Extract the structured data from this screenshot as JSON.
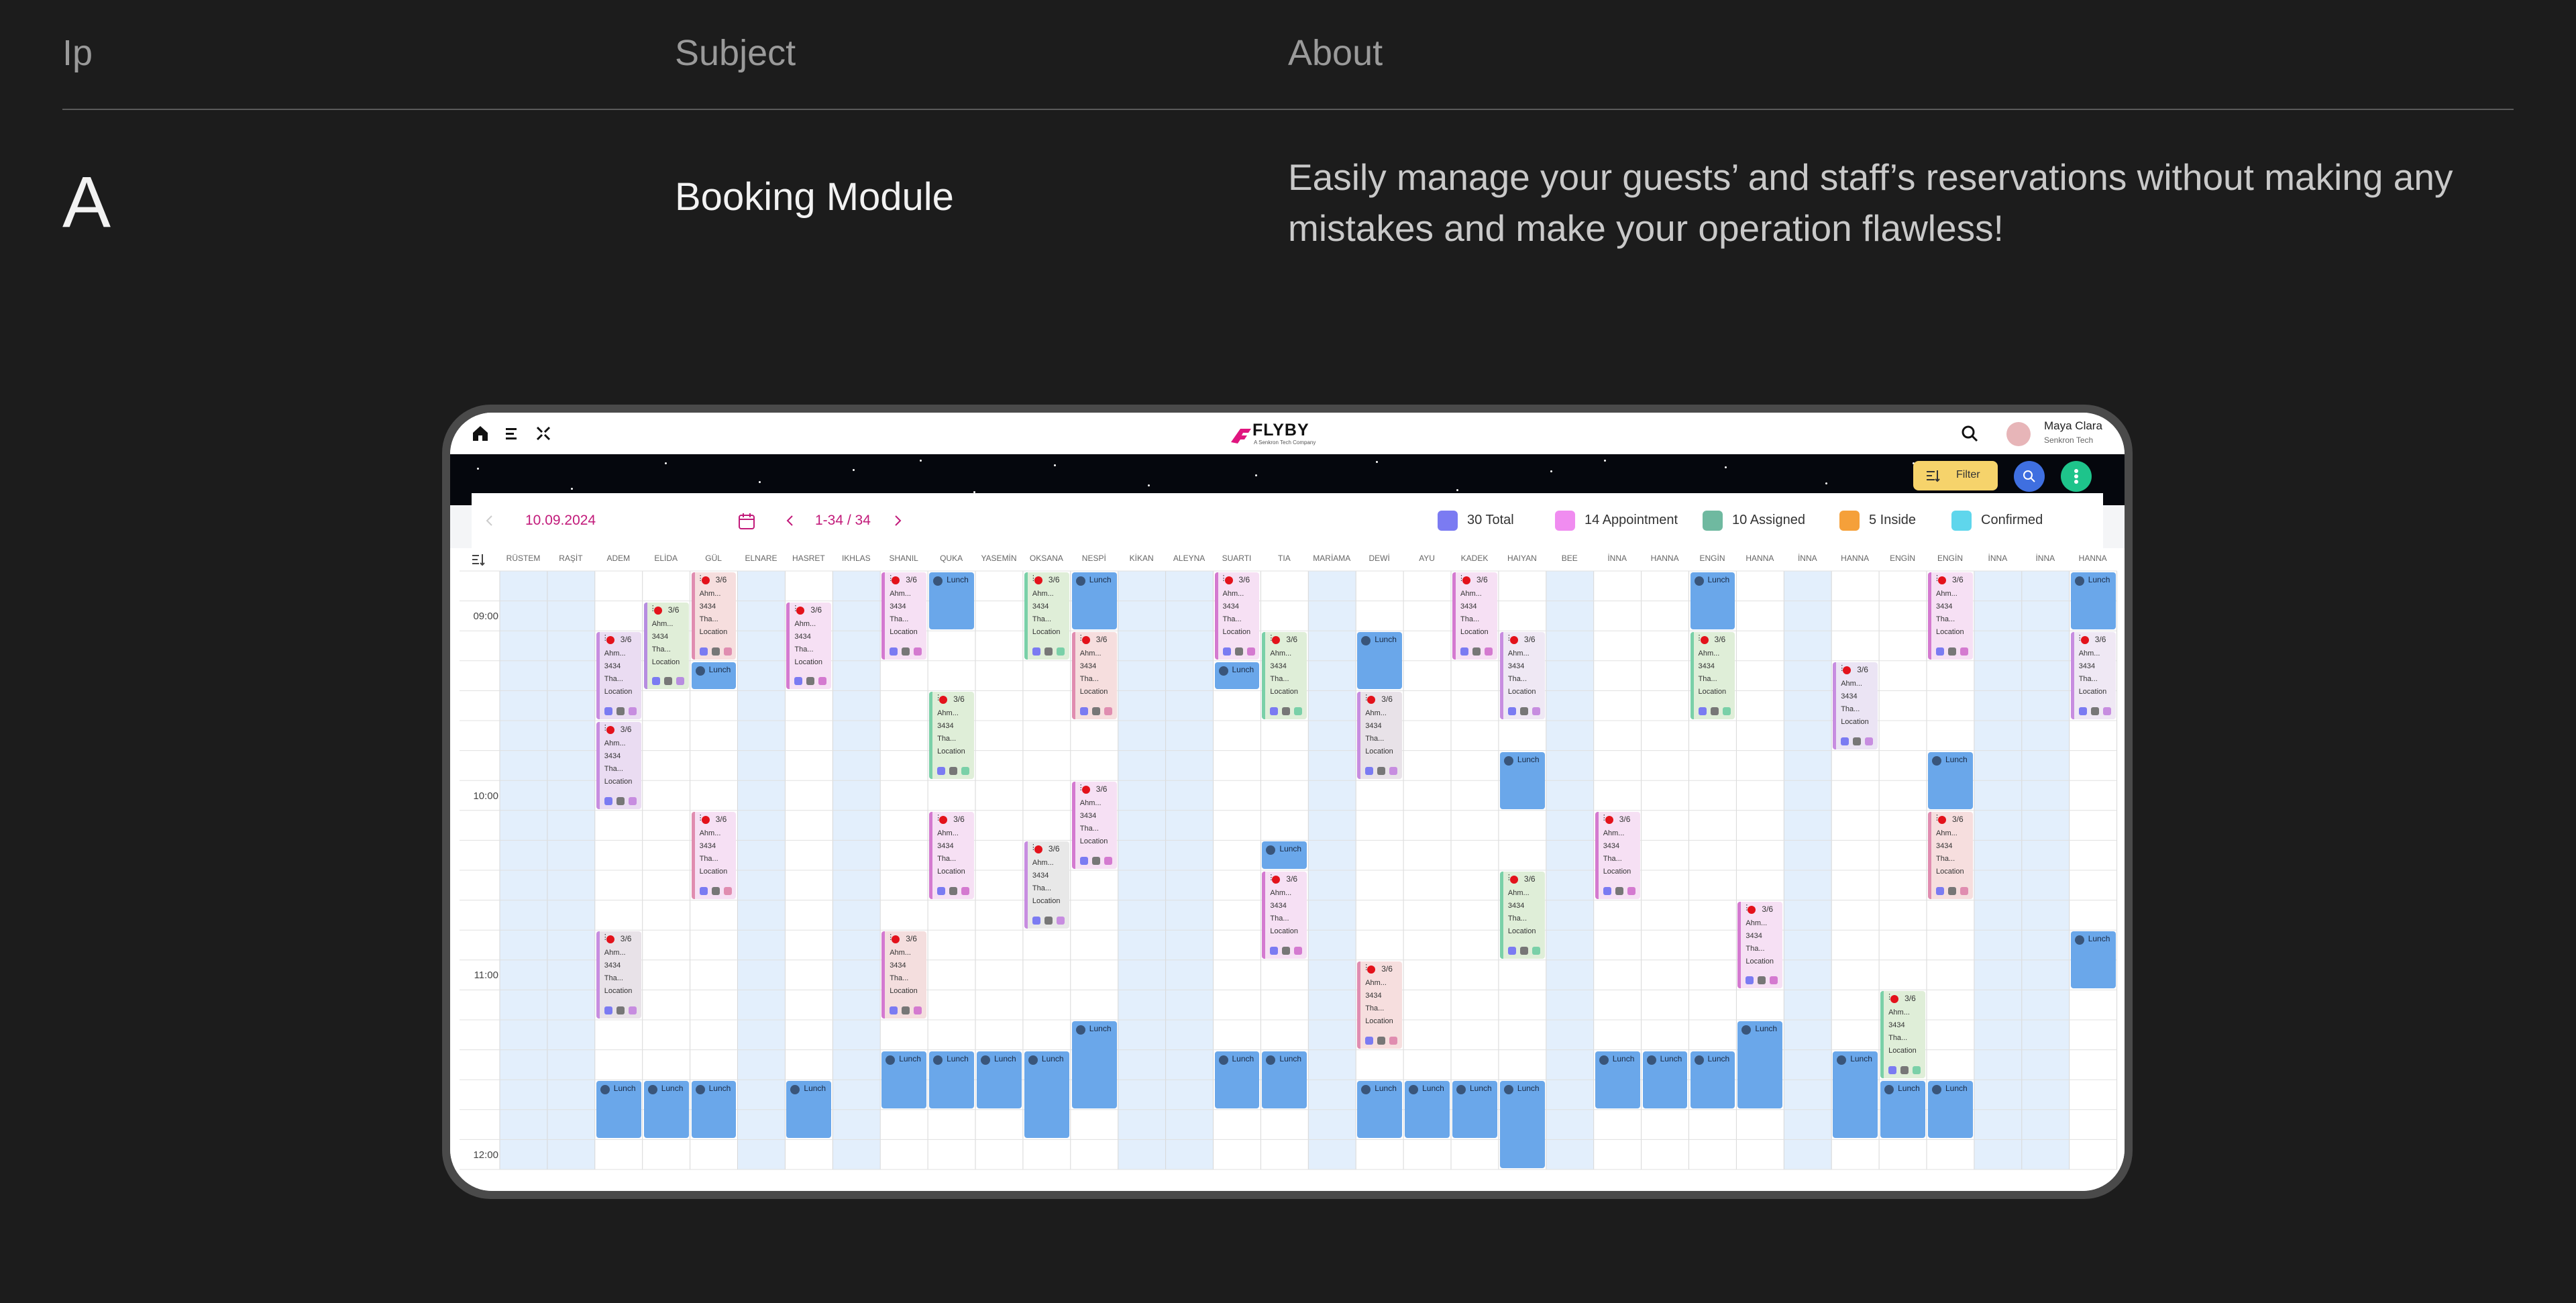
{
  "slide": {
    "col_headers": [
      "Ip",
      "Subject",
      "About"
    ],
    "row_letter": "A",
    "subject": "Booking Module",
    "about": "Easily manage your guests’ and staff’s reservations without making any mistakes and make your operation flawless!"
  },
  "app": {
    "logo_text": "FLYBY",
    "logo_sub": "A Senkron Tech Company",
    "user_name": "Maya Clara",
    "user_org": "Senkron Tech",
    "filter_label": "Filter",
    "date": "10.09.2024",
    "pager": "1-34 / 34",
    "legend": [
      {
        "label": "30 Total",
        "color": "#7b7bf2"
      },
      {
        "label": "14 Appointment",
        "color": "#f08cf0"
      },
      {
        "label": "10 Assigned",
        "color": "#6fb9a0"
      },
      {
        "label": "5 Inside",
        "color": "#f5a03a"
      },
      {
        "label": "Confirmed",
        "color": "#5fd6ec"
      }
    ],
    "columns": [
      "RÜSTEM",
      "RAŞİT",
      "ADEM",
      "ELİDA",
      "GÜL",
      "ELNARE",
      "HASRET",
      "IKHLAS",
      "SHANIL",
      "QUKA",
      "YASEMİN",
      "OKSANA",
      "NESPİ",
      "KİKAN",
      "ALEYNA",
      "SUARTI",
      "TIA",
      "MARİAMA",
      "DEWİ",
      "AYU",
      "KADEK",
      "HAIYAN",
      "BEE",
      "İNNA",
      "HANNA",
      "ENGİN",
      "HANNA",
      "İNNA",
      "HANNA",
      "ENGİN",
      "ENGİN",
      "İNNA",
      "İNNA",
      "HANNA"
    ],
    "times": [
      "09:00",
      "10:00",
      "11:00",
      "12:00"
    ],
    "appt_text": {
      "count": "3/6",
      "name": "Ahm...",
      "id": "3434",
      "type": "Tha...",
      "location": "Location"
    },
    "lunch_label": "Lunch"
  }
}
